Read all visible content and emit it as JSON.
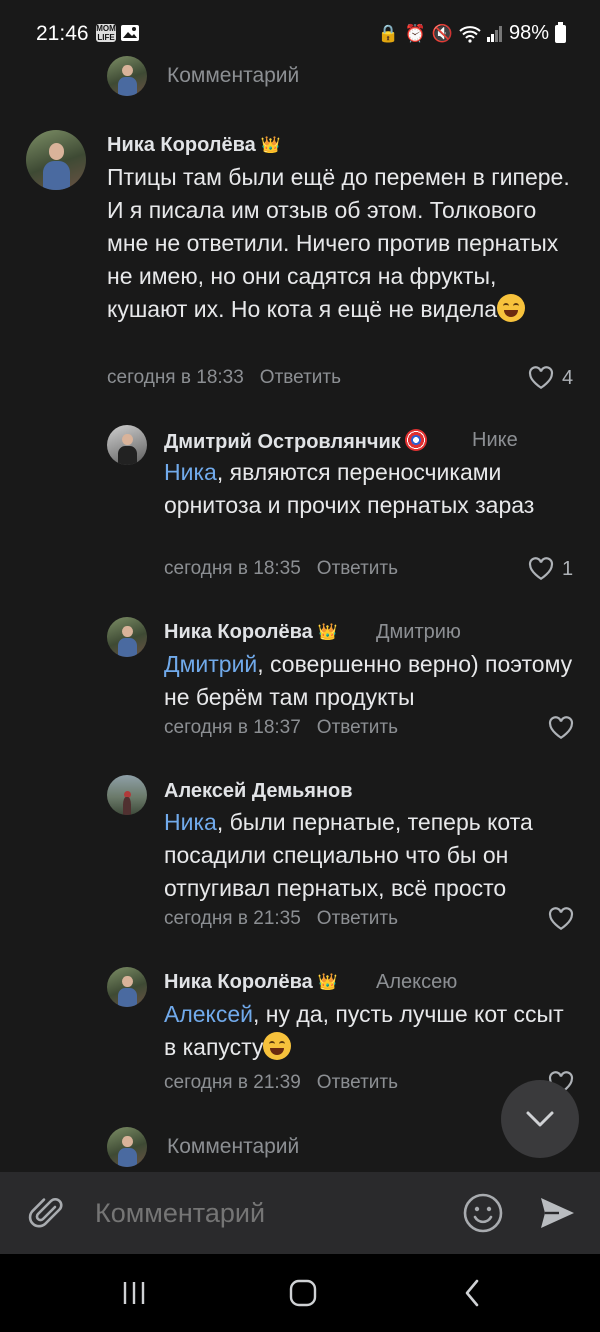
{
  "status_bar": {
    "time": "21:46",
    "app_badge": "MOM LIFE",
    "battery": "98%"
  },
  "top_prompt": {
    "placeholder": "Комментарий"
  },
  "comments": [
    {
      "author": "Ника Королёва",
      "text": "Птицы там были ещё до перемен в гипере. И я писала им отзыв об этом. Толкового мне не ответили. Ничего против пернатых не имею, но они садятся на фрукты, кушают их. Но кота я ещё не видела",
      "time": "сегодня в 18:33",
      "reply": "Ответить",
      "likes": "4"
    },
    {
      "author": "Дмитрий Островлянчик",
      "reply_to": "Нике",
      "mention": "Ника",
      "text": ", являются переносчиками орнитоза и прочих пернатых зараз",
      "time": "сегодня в 18:35",
      "reply": "Ответить",
      "likes": "1"
    },
    {
      "author": "Ника Королёва",
      "reply_to": "Дмитрию",
      "mention": "Дмитрий",
      "text": ", совершенно верно) поэтому не берём там продукты",
      "time": "сегодня в 18:37",
      "reply": "Ответить"
    },
    {
      "author": "Алексей Демьянов",
      "mention": "Ника",
      "text": ", были пернатые, теперь кота посадили специально что бы он отпугивал пернатых, всё просто",
      "time": "сегодня в 21:35",
      "reply": "Ответить"
    },
    {
      "author": "Ника Королёва",
      "reply_to": "Алексею",
      "mention": "Алексей",
      "text": ", ну да, пусть лучше кот ссыт в капусту",
      "time": "сегодня в 21:39",
      "reply": "Ответить"
    }
  ],
  "bottom_prompt": {
    "placeholder": "Комментарий"
  },
  "composer": {
    "placeholder": "Комментарий"
  },
  "colors": {
    "background": "#191919",
    "mention": "#71aaeb",
    "muted": "#8c8f93"
  }
}
